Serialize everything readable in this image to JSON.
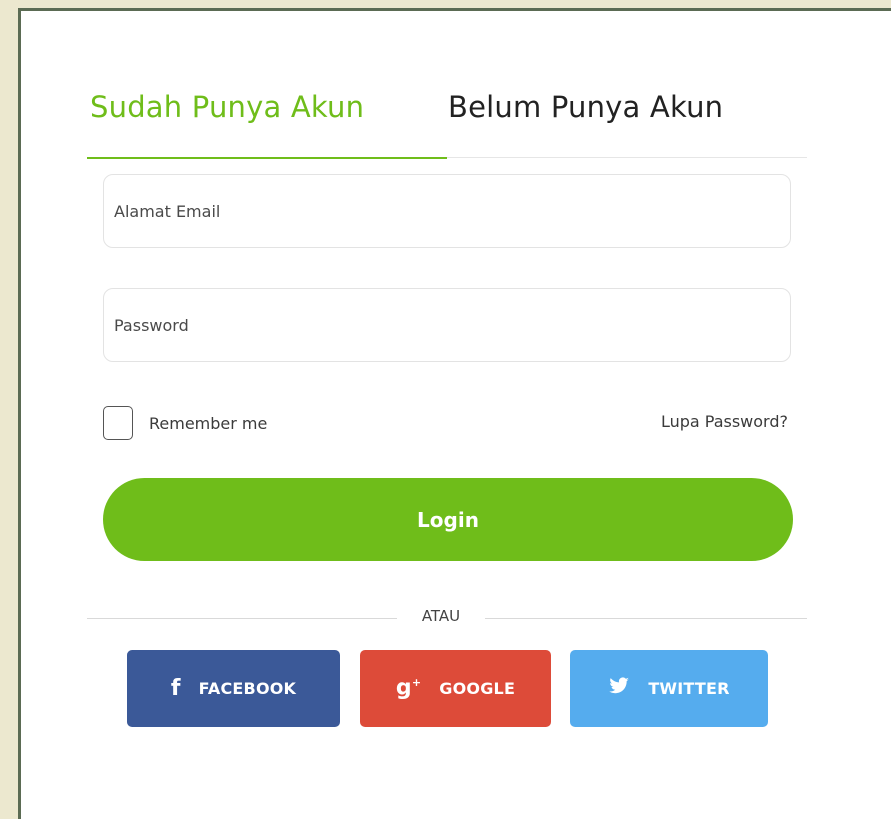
{
  "tabs": {
    "login": "Sudah Punya Akun",
    "register": "Belum Punya Akun"
  },
  "form": {
    "email_placeholder": "Alamat Email",
    "password_placeholder": "Password",
    "remember_label": "Remember me",
    "forgot_label": "Lupa Password?",
    "login_label": "Login",
    "divider_text": "ATAU"
  },
  "social": {
    "facebook_label": "FACEBOOK",
    "google_label": "GOOGLE",
    "twitter_label": "TWITTER",
    "facebook_icon": "facebook-icon",
    "google_icon": "google-plus-icon",
    "twitter_icon": "twitter-bird-icon"
  },
  "colors": {
    "accent": "#6fbd1a",
    "facebook": "#3b5998",
    "google": "#dd4b39",
    "twitter": "#55acee"
  }
}
